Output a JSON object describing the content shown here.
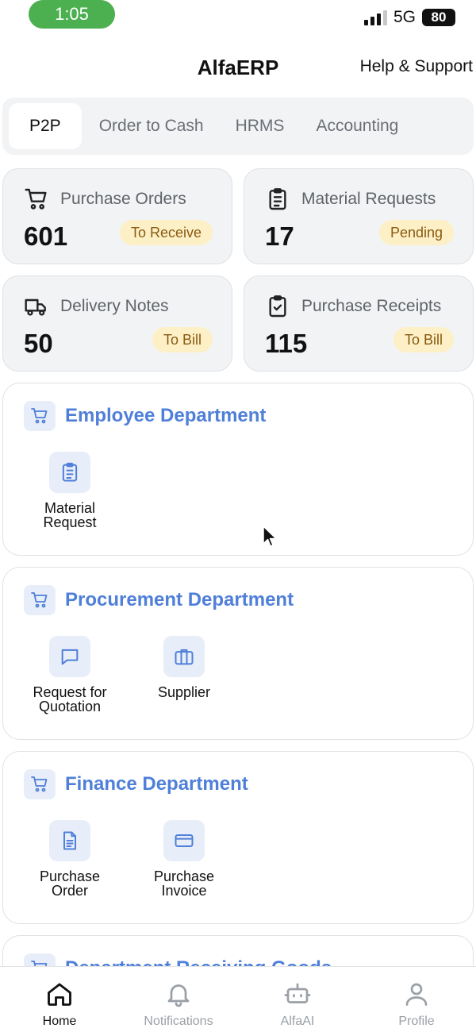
{
  "status_bar": {
    "time": "1:05",
    "network": "5G",
    "battery": "80"
  },
  "header": {
    "title": "AlfaERP",
    "help_label": "Help & Support"
  },
  "tabs": [
    {
      "label": "P2P",
      "active": true
    },
    {
      "label": "Order to Cash"
    },
    {
      "label": "HRMS"
    },
    {
      "label": "Accounting"
    }
  ],
  "stats": [
    {
      "icon": "cart-icon",
      "label": "Purchase Orders",
      "value": "601",
      "badge": "To Receive"
    },
    {
      "icon": "clipboard-list-icon",
      "label": "Material Requests",
      "value": "17",
      "badge": "Pending"
    },
    {
      "icon": "truck-icon",
      "label": "Delivery Notes",
      "value": "50",
      "badge": "To Bill"
    },
    {
      "icon": "clipboard-check-icon",
      "label": "Purchase Receipts",
      "value": "115",
      "badge": "To Bill"
    }
  ],
  "departments": [
    {
      "title": "Employee Department",
      "items": [
        {
          "icon": "clipboard-list-icon",
          "line1": "Material",
          "line2": "Request"
        }
      ]
    },
    {
      "title": "Procurement Department",
      "items": [
        {
          "icon": "chat-bubble-icon",
          "line1": "Request for",
          "line2": "Quotation"
        },
        {
          "icon": "briefcase-icon",
          "line1": "Supplier",
          "line2": ""
        }
      ]
    },
    {
      "title": "Finance Department",
      "items": [
        {
          "icon": "document-icon",
          "line1": "Purchase",
          "line2": "Order"
        },
        {
          "icon": "credit-card-icon",
          "line1": "Purchase",
          "line2": "Invoice"
        }
      ]
    },
    {
      "title": "Department Receiving Goods",
      "items": []
    }
  ],
  "nav": [
    {
      "label": "Home",
      "icon": "home-icon",
      "active": true
    },
    {
      "label": "Notifications",
      "icon": "bell-icon"
    },
    {
      "label": "AlfaAI",
      "icon": "robot-icon"
    },
    {
      "label": "Profile",
      "icon": "user-icon"
    }
  ],
  "colors": {
    "accent": "#4f7fd8",
    "badge_bg": "#fdf0c7",
    "badge_text": "#8a5a10",
    "time_pill": "#4caf50"
  }
}
